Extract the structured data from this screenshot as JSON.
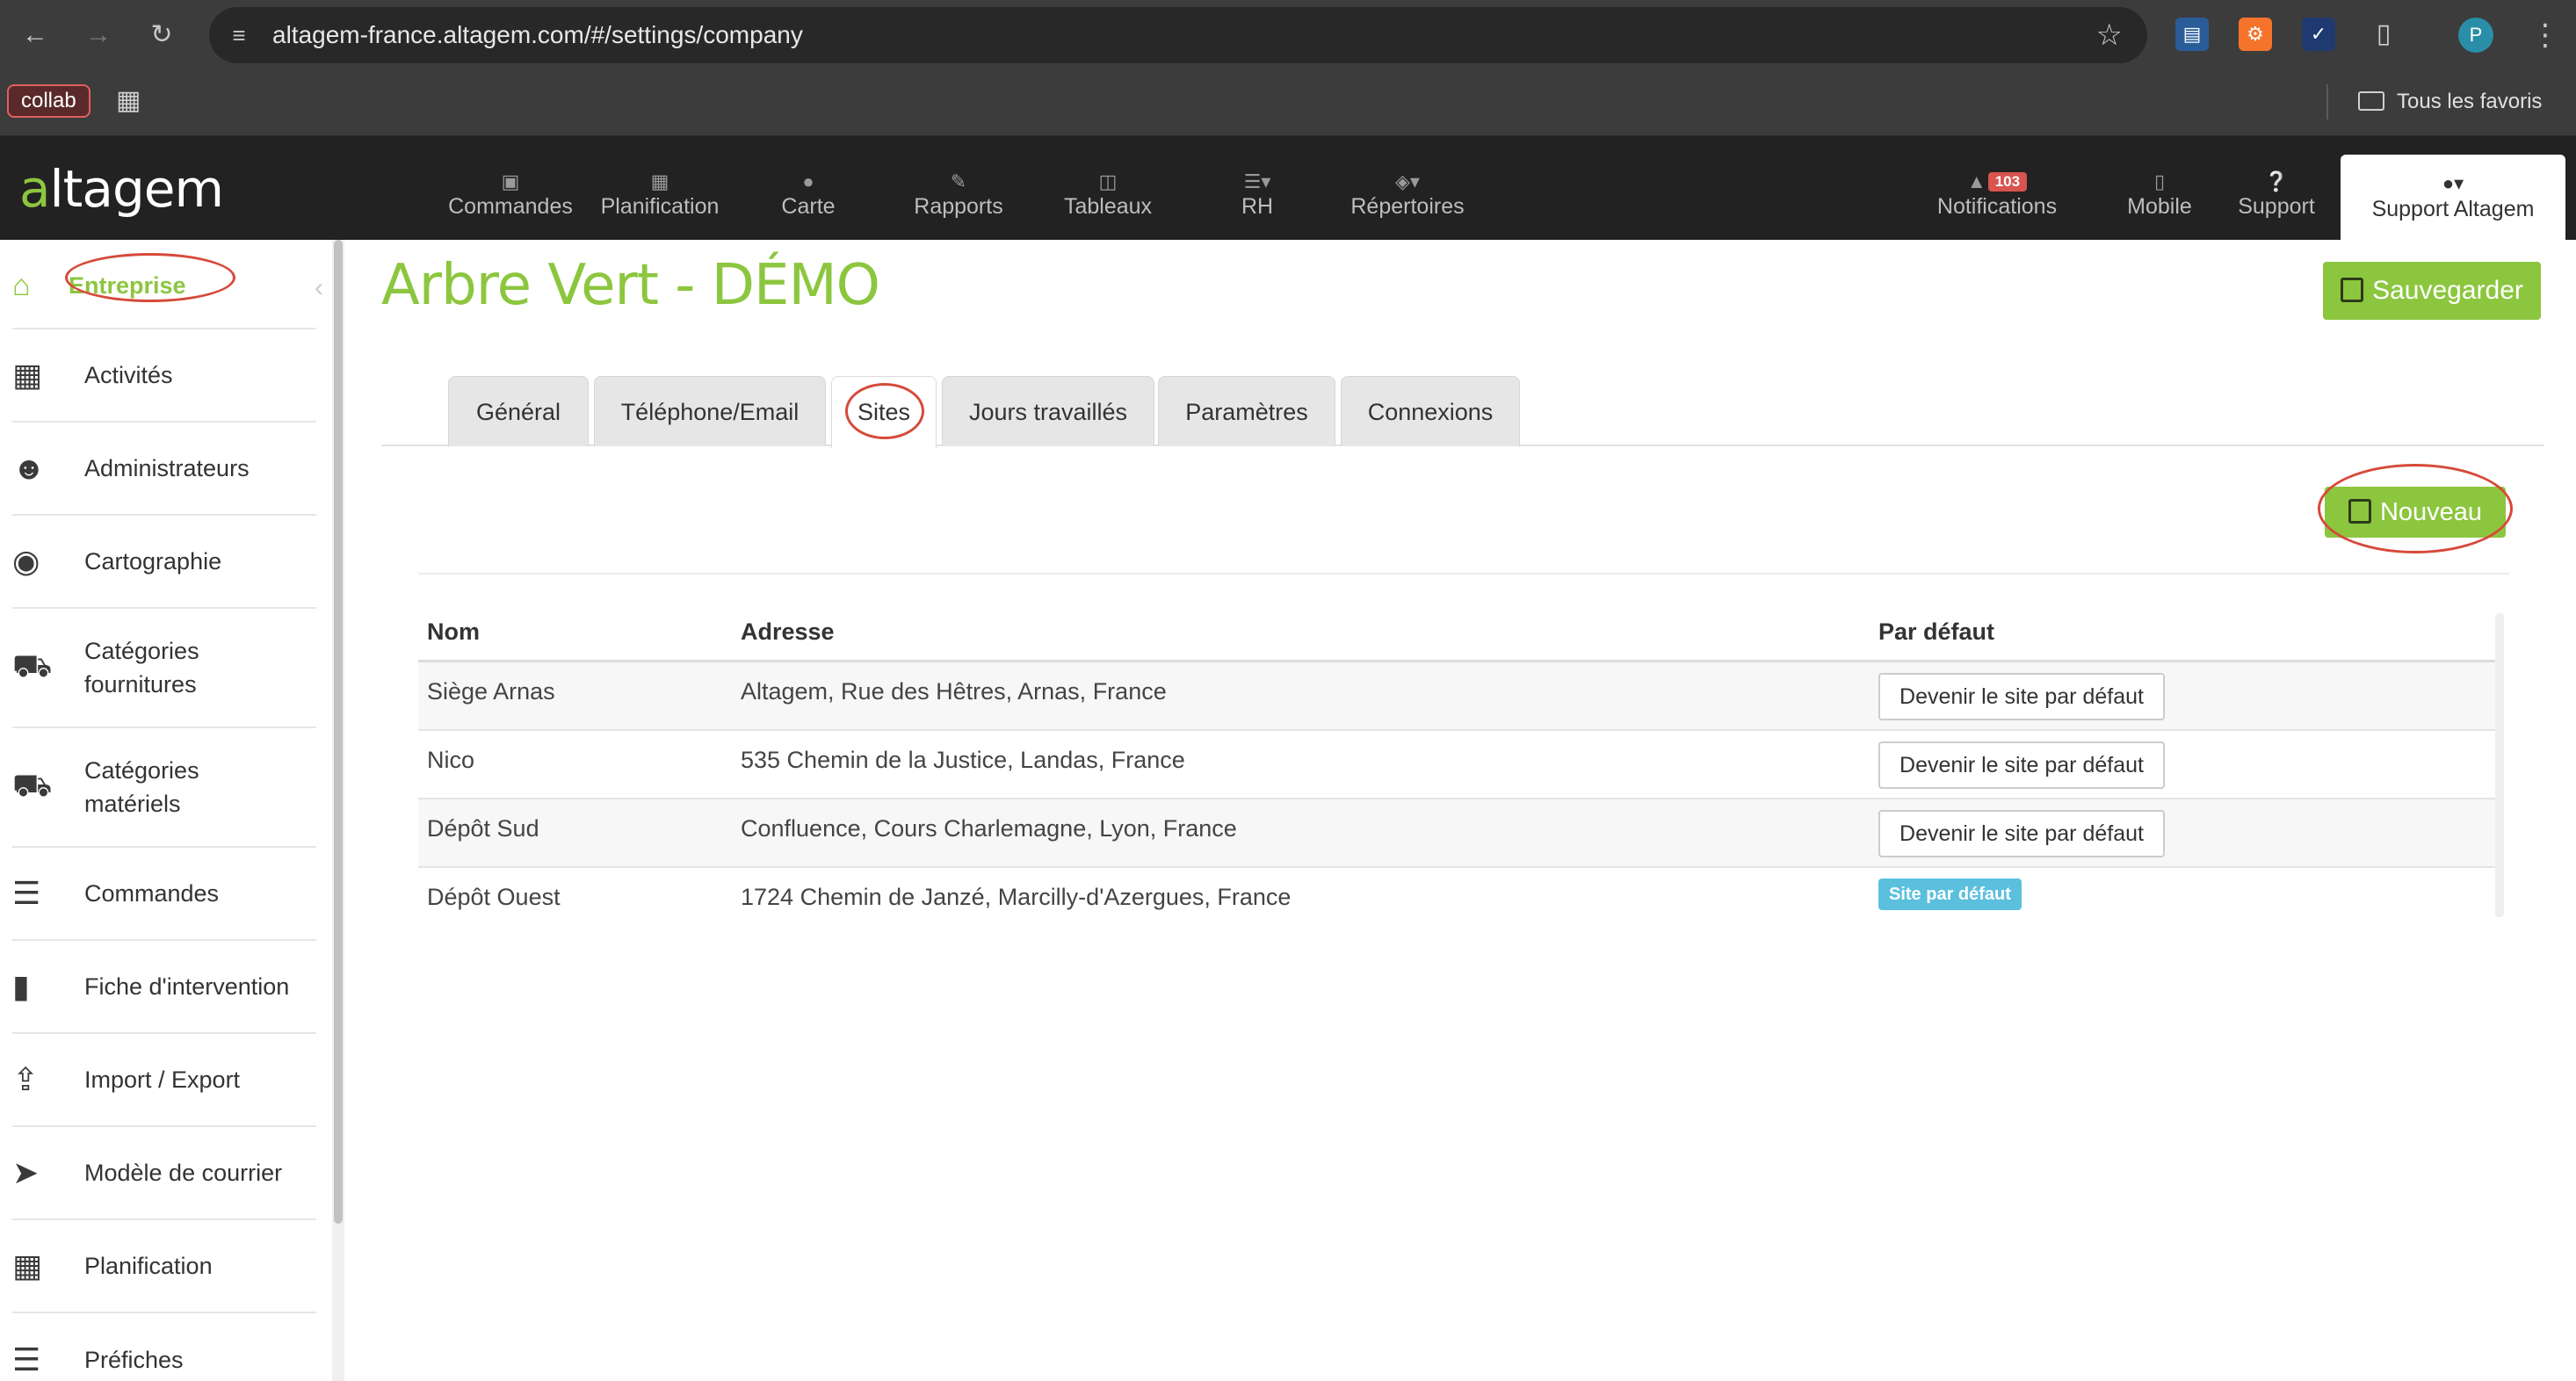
{
  "browser": {
    "url": "altagem-france.altagem.com/#/settings/company",
    "bookmark_label": "collab",
    "favorites_label": "Tous les favoris",
    "profile_initial": "P"
  },
  "navbar": {
    "logo": "altagem",
    "items": [
      {
        "label": "Commandes",
        "icon": "inbox-icon"
      },
      {
        "label": "Planification",
        "icon": "calendar-icon"
      },
      {
        "label": "Carte",
        "icon": "map-marker-icon"
      },
      {
        "label": "Rapports",
        "icon": "edit-icon"
      },
      {
        "label": "Tableaux",
        "icon": "columns-icon"
      },
      {
        "label": "RH",
        "icon": "list-icon"
      },
      {
        "label": "Répertoires",
        "icon": "cube-icon"
      }
    ],
    "notifications": {
      "label": "Notifications",
      "count": "103"
    },
    "mobile_label": "Mobile",
    "support_label": "Support",
    "user_label": "Support Altagem"
  },
  "sidebar": {
    "items": [
      {
        "label": "Entreprise",
        "icon": "home-icon",
        "active": true
      },
      {
        "label": "Activités",
        "icon": "dashboard-icon"
      },
      {
        "label": "Administrateurs",
        "icon": "users-icon"
      },
      {
        "label": "Cartographie",
        "icon": "map-marker-icon"
      },
      {
        "label": "Catégories fournitures",
        "icon": "cart-icon"
      },
      {
        "label": "Catégories matériels",
        "icon": "truck-icon"
      },
      {
        "label": "Commandes",
        "icon": "list-icon"
      },
      {
        "label": "Fiche d'intervention",
        "icon": "file-icon"
      },
      {
        "label": "Import / Export",
        "icon": "upload-icon"
      },
      {
        "label": "Modèle de courrier",
        "icon": "paper-plane-icon"
      },
      {
        "label": "Planification",
        "icon": "calendar-icon"
      },
      {
        "label": "Préfiches",
        "icon": "server-icon"
      }
    ]
  },
  "main": {
    "title": "Arbre Vert - DÉMO",
    "save_label": "Sauvegarder",
    "new_label": "Nouveau",
    "tabs": [
      {
        "label": "Général"
      },
      {
        "label": "Téléphone/Email"
      },
      {
        "label": "Sites",
        "active": true
      },
      {
        "label": "Jours travaillés"
      },
      {
        "label": "Paramètres"
      },
      {
        "label": "Connexions"
      }
    ],
    "table": {
      "headers": {
        "name": "Nom",
        "address": "Adresse",
        "default": "Par défaut"
      },
      "rows": [
        {
          "name": "Siège Arnas",
          "address": "Altagem, Rue des Hêtres, Arnas, France",
          "action": "Devenir le site par défaut"
        },
        {
          "name": "Nico",
          "address": "535 Chemin de la Justice, Landas, France",
          "action": "Devenir le site par défaut"
        },
        {
          "name": "Dépôt Sud",
          "address": "Confluence, Cours Charlemagne, Lyon, France",
          "action": "Devenir le site par défaut"
        },
        {
          "name": "Dépôt Ouest",
          "address": "1724 Chemin de Janzé, Marcilly-d'Azergues, France",
          "badge": "Site par défaut"
        }
      ]
    }
  },
  "colors": {
    "brand_green": "#8cc63f",
    "info_blue": "#5bc0de",
    "annotation_red": "#d64a3a",
    "badge_red": "#d9534f"
  }
}
